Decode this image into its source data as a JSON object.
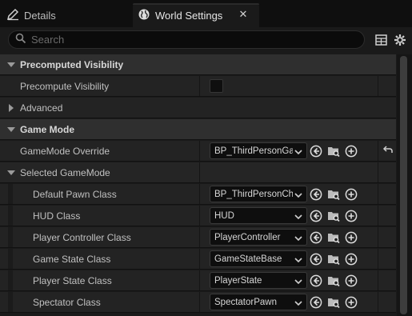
{
  "tabs": {
    "details": {
      "label": "Details"
    },
    "world_settings": {
      "label": "World Settings"
    }
  },
  "search": {
    "placeholder": "Search",
    "value": ""
  },
  "sections": {
    "precomputed_visibility": {
      "title": "Precomputed Visibility",
      "precompute_visibility": {
        "label": "Precompute Visibility",
        "checked": false
      }
    },
    "advanced": {
      "title": "Advanced"
    },
    "game_mode": {
      "title": "Game Mode",
      "gamemode_override": {
        "label": "GameMode Override",
        "value": "BP_ThirdPersonGameMode"
      },
      "selected_gamemode": {
        "title": "Selected GameMode",
        "properties": [
          {
            "label": "Default Pawn Class",
            "value": "BP_ThirdPersonCharacter"
          },
          {
            "label": "HUD Class",
            "value": "HUD"
          },
          {
            "label": "Player Controller Class",
            "value": "PlayerController"
          },
          {
            "label": "Game State Class",
            "value": "GameStateBase"
          },
          {
            "label": "Player State Class",
            "value": "PlayerState"
          },
          {
            "label": "Spectator Class",
            "value": "SpectatorPawn"
          }
        ]
      }
    }
  },
  "icons": {
    "details_tab": "pencil-icon",
    "world_tab": "globe-icon",
    "close": "close-icon",
    "search": "search-icon",
    "table": "table-icon",
    "settings": "gear-icon",
    "use_selected": "arrow-left-circle-icon",
    "browse": "folder-search-icon",
    "add": "plus-circle-icon",
    "reset": "reset-arrow-icon"
  },
  "colors": {
    "background": "#1a1a1a",
    "category": "#2f2f2f",
    "row": "#232323",
    "field": "#0e0e0e"
  }
}
